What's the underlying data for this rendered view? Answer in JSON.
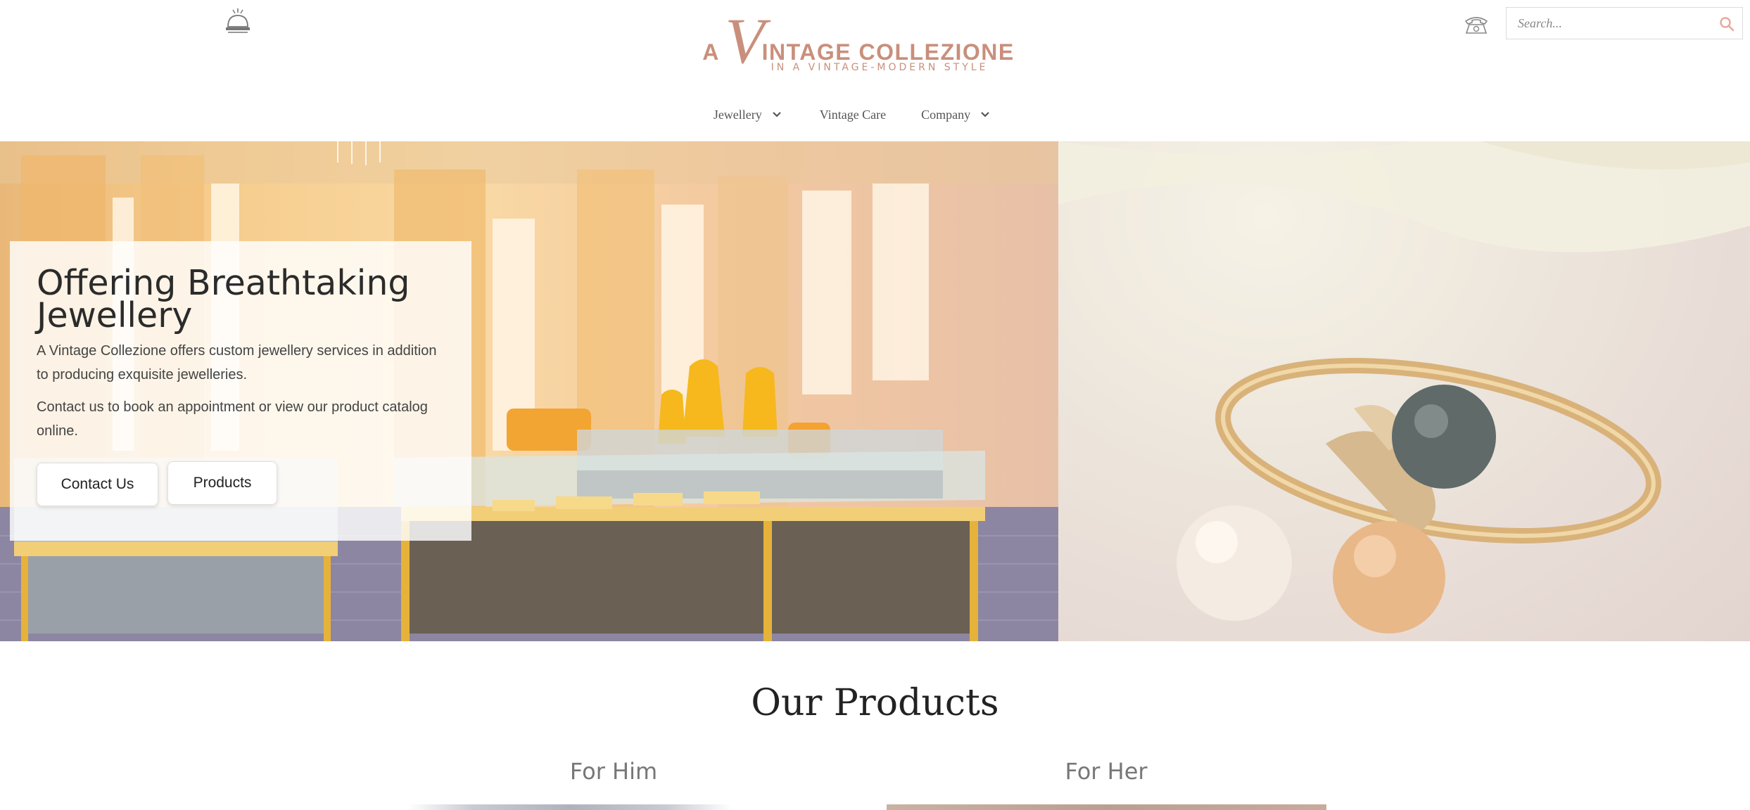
{
  "header": {
    "logo": {
      "prefix": "A",
      "initial": "V",
      "rest": "INTAGE COLLEZIONE",
      "tagline": "IN A VINTAGE-MODERN STYLE"
    },
    "search": {
      "placeholder": "Search..."
    },
    "icons": {
      "left": "service-bell-icon",
      "phone": "telephone-icon",
      "search": "search-icon"
    }
  },
  "nav": {
    "items": [
      {
        "label": "Jewellery",
        "has_dropdown": true
      },
      {
        "label": "Vintage Care",
        "has_dropdown": false
      },
      {
        "label": "Company",
        "has_dropdown": true
      }
    ]
  },
  "hero": {
    "title": "Offering Breathtaking Jewellery",
    "paragraph1": "A Vintage Collezione offers custom jewellery services in addition to producing exquisite jewelleries.",
    "paragraph2": "Contact us to book an appointment or view our product catalog online.",
    "buttons": {
      "contact": "Contact Us",
      "products": "Products"
    }
  },
  "products": {
    "heading": "Our Products",
    "columns": [
      {
        "label": "For Him"
      },
      {
        "label": "For Her"
      }
    ]
  },
  "colors": {
    "brand": "#c98f7c",
    "search_icon": "#e8a89a",
    "text_dark": "#2b2b2b"
  }
}
